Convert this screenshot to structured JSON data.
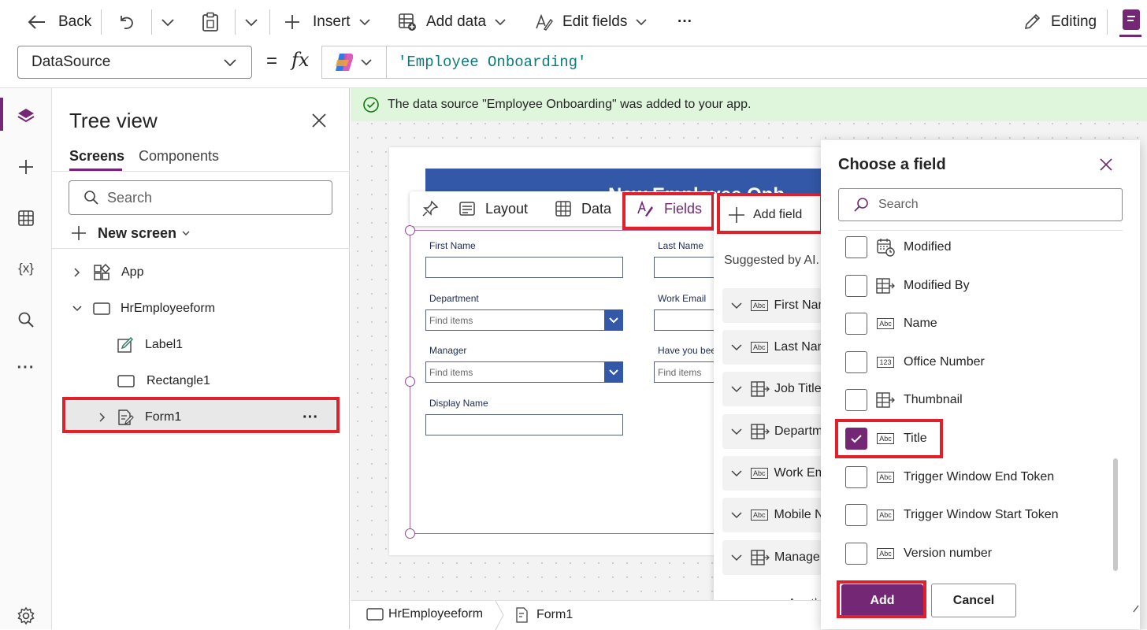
{
  "toolbar": {
    "back": "Back",
    "insert": "Insert",
    "add_data": "Add data",
    "edit_fields": "Edit fields",
    "more": "···",
    "editing": "Editing"
  },
  "formula_bar": {
    "property": "DataSource",
    "equals": "=",
    "fx": "fx",
    "formula": "'Employee Onboarding'"
  },
  "tree": {
    "title": "Tree view",
    "tabs": [
      "Screens",
      "Components"
    ],
    "search_placeholder": "Search",
    "new_screen": "New screen",
    "items": [
      {
        "label": "App"
      },
      {
        "label": "HrEmployeeform"
      },
      {
        "label": "Label1"
      },
      {
        "label": "Rectangle1"
      },
      {
        "label": "Form1"
      }
    ]
  },
  "banner": "The data source \"Employee Onboarding\" was added to your app.",
  "form": {
    "header_text": "New Employee Onb",
    "toolbar": {
      "layout": "Layout",
      "data": "Data",
      "fields": "Fields"
    },
    "fields": {
      "first_name": "First Name",
      "last_name": "Last Name",
      "department": "Department",
      "work_email": "Work Email",
      "manager": "Manager",
      "have_you_been": "Have you bee",
      "display_name": "Display Name",
      "find_items": "Find items"
    }
  },
  "fields_panel": {
    "add_field": "Add field",
    "suggested": "Suggested by AI.",
    "items": [
      "First Nam",
      "Last Nam",
      "Job Title",
      "Departm",
      "Work Em",
      "Mobile N",
      "Manage"
    ],
    "footer": "Are th"
  },
  "choose_field": {
    "title": "Choose a field",
    "search_placeholder": "Search",
    "options": [
      {
        "label": "Modified",
        "icon": "calendar-icon",
        "checked": false
      },
      {
        "label": "Modified By",
        "icon": "person-lookup-icon",
        "checked": false
      },
      {
        "label": "Name",
        "icon": "abc-icon",
        "checked": false
      },
      {
        "label": "Office Number",
        "icon": "number-icon",
        "checked": false
      },
      {
        "label": "Thumbnail",
        "icon": "person-lookup-icon",
        "checked": false
      },
      {
        "label": "Title",
        "icon": "abc-icon",
        "checked": true
      },
      {
        "label": "Trigger Window End Token",
        "icon": "abc-icon",
        "checked": false
      },
      {
        "label": "Trigger Window Start Token",
        "icon": "abc-icon",
        "checked": false
      },
      {
        "label": "Version number",
        "icon": "abc-icon",
        "checked": false
      }
    ],
    "add_button": "Add",
    "cancel_button": "Cancel"
  },
  "breadcrumb": [
    "HrEmployeeform",
    "Form1"
  ],
  "colors": {
    "accent": "#742774",
    "highlight": "#e2202a",
    "form_header": "#3358a8",
    "banner": "#dff6dd"
  }
}
